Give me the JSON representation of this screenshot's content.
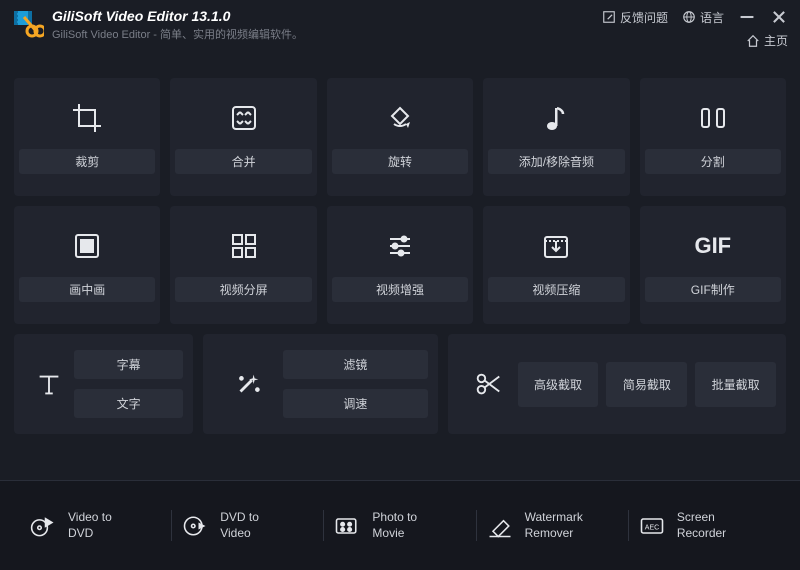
{
  "header": {
    "app_title": "GiliSoft Video Editor 13.1.0",
    "app_subtitle": "GiliSoft Video Editor - 简单、实用的视频编辑软件。",
    "feedback": "反馈问题",
    "language": "语言",
    "home": "主页"
  },
  "tiles": {
    "crop": "裁剪",
    "merge": "合并",
    "rotate": "旋转",
    "audio": "添加/移除音频",
    "split": "分割",
    "pip": "画中画",
    "multiscreen": "视频分屏",
    "enhance": "视频增强",
    "compress": "视频压缩",
    "gif": "GIF制作"
  },
  "row3": {
    "text_icon_tile": {
      "subtitle": "字幕",
      "text": "文字"
    },
    "magic_tile": {
      "filter": "滤镜",
      "speed": "调速"
    },
    "clip_tile": {
      "advanced": "高级截取",
      "simple": "简易截取",
      "batch": "批量截取"
    }
  },
  "footer": {
    "item1": "Video to\nDVD",
    "item2": "DVD to\nVideo",
    "item3": "Photo to\nMovie",
    "item4": "Watermark\nRemover",
    "item5": "Screen\nRecorder"
  }
}
